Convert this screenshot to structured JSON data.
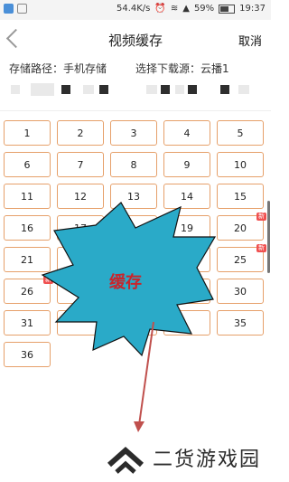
{
  "status_bar": {
    "network_speed": "54.4K/s",
    "battery": "59%",
    "time": "19:37"
  },
  "header": {
    "title": "视频缓存",
    "cancel_label": "取消"
  },
  "info": {
    "path_label": "存储路径：手机存储",
    "source_label": "选择下载源：云播1"
  },
  "episodes": [
    {
      "num": "1"
    },
    {
      "num": "2"
    },
    {
      "num": "3"
    },
    {
      "num": "4"
    },
    {
      "num": "5"
    },
    {
      "num": "6"
    },
    {
      "num": "7"
    },
    {
      "num": "8"
    },
    {
      "num": "9"
    },
    {
      "num": "10"
    },
    {
      "num": "11"
    },
    {
      "num": "12"
    },
    {
      "num": "13"
    },
    {
      "num": "14"
    },
    {
      "num": "15"
    },
    {
      "num": "16"
    },
    {
      "num": "17"
    },
    {
      "num": ""
    },
    {
      "num": "19"
    },
    {
      "num": "20",
      "badge": "新"
    },
    {
      "num": "21"
    },
    {
      "num": ""
    },
    {
      "num": ""
    },
    {
      "num": ""
    },
    {
      "num": "25",
      "badge": "新"
    },
    {
      "num": "26",
      "badge": "新"
    },
    {
      "num": ""
    },
    {
      "num": ""
    },
    {
      "num": ""
    },
    {
      "num": "30"
    },
    {
      "num": "31"
    },
    {
      "num": ""
    },
    {
      "num": ""
    },
    {
      "num": ""
    },
    {
      "num": "35"
    },
    {
      "num": "36"
    }
  ],
  "overlay": {
    "label": "缓存",
    "fill_color": "#2aaac8",
    "arrow_color": "#c0504d"
  },
  "watermark": {
    "text": "二货游戏园"
  }
}
